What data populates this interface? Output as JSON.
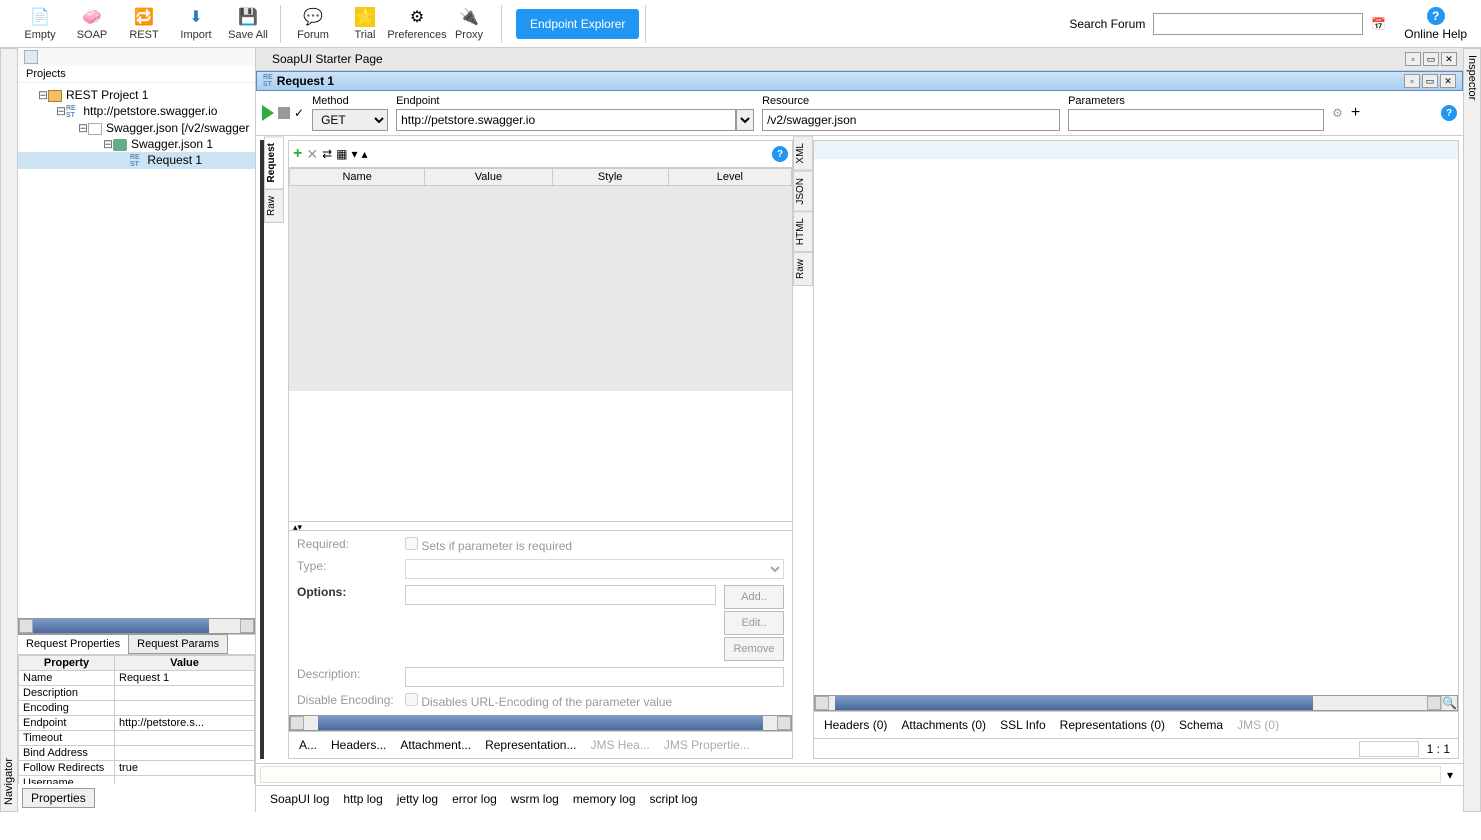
{
  "toolbar": {
    "items": [
      {
        "label": "Empty",
        "icon": "📄"
      },
      {
        "label": "SOAP",
        "icon": "🧼"
      },
      {
        "label": "REST",
        "icon": "🔁"
      },
      {
        "label": "Import",
        "icon": "⬇"
      },
      {
        "label": "Save All",
        "icon": "💾"
      },
      {
        "label": "Forum",
        "icon": "💬"
      },
      {
        "label": "Trial",
        "icon": "⭐"
      },
      {
        "label": "Preferences",
        "icon": "⚙"
      },
      {
        "label": "Proxy",
        "icon": "🔌"
      }
    ],
    "endpoint_explorer": "Endpoint Explorer",
    "search_label": "Search Forum",
    "search_placeholder": "",
    "help_label": "Online Help"
  },
  "side_nav_left": "Navigator",
  "side_nav_right": "Inspector",
  "projects_label": "Projects",
  "tree": [
    {
      "label": "REST Project 1",
      "indent": 0,
      "icon": "folder",
      "exp": "⊟"
    },
    {
      "label": "http://petstore.swagger.io",
      "indent": 1,
      "icon": "rest",
      "exp": "⊟"
    },
    {
      "label": "Swagger.json [/v2/swagger",
      "indent": 2,
      "icon": "file",
      "exp": "⊟"
    },
    {
      "label": "Swagger.json 1",
      "indent": 3,
      "icon": "swag",
      "exp": "⊟"
    },
    {
      "label": "Request 1",
      "indent": 4,
      "icon": "rest",
      "selected": true
    }
  ],
  "prop_tabs": [
    {
      "label": "Request Properties",
      "active": true
    },
    {
      "label": "Request Params"
    }
  ],
  "prop_table": {
    "headers": [
      "Property",
      "Value"
    ],
    "rows": [
      [
        "Name",
        "Request 1"
      ],
      [
        "Description",
        ""
      ],
      [
        "Encoding",
        ""
      ],
      [
        "Endpoint",
        "http://petstore.s..."
      ],
      [
        "Timeout",
        ""
      ],
      [
        "Bind Address",
        ""
      ],
      [
        "Follow Redirects",
        "true"
      ],
      [
        "Username",
        ""
      ]
    ]
  },
  "properties_btn": "Properties",
  "outer_tab": "SoapUI Starter Page",
  "request_tab": "Request 1",
  "editor": {
    "method_label": "Method",
    "method": "GET",
    "endpoint_label": "Endpoint",
    "endpoint": "http://petstore.swagger.io",
    "resource_label": "Resource",
    "resource": "/v2/swagger.json",
    "parameters_label": "Parameters",
    "parameters": ""
  },
  "param_grid": {
    "headers": [
      "Name",
      "Value",
      "Style",
      "Level"
    ]
  },
  "param_detail": {
    "required_label": "Required:",
    "required_hint": "Sets if parameter is required",
    "type_label": "Type:",
    "options_label": "Options:",
    "add": "Add..",
    "edit": "Edit..",
    "remove": "Remove",
    "description_label": "Description:",
    "disable_enc_label": "Disable Encoding:",
    "disable_enc_hint": "Disables URL-Encoding of the parameter value"
  },
  "left_vtabs": [
    "Request",
    "Raw"
  ],
  "right_vtabs": [
    "XML",
    "JSON",
    "HTML",
    "Raw"
  ],
  "left_bottom_tabs": [
    "A...",
    "Headers...",
    "Attachment...",
    "Representation...",
    "JMS Hea...",
    "JMS Propertie..."
  ],
  "right_bottom_tabs": [
    "Headers (0)",
    "Attachments (0)",
    "SSL Info",
    "Representations (0)",
    "Schema",
    "JMS (0)"
  ],
  "status_ratio": "1 : 1",
  "log_tabs": [
    "SoapUI log",
    "http log",
    "jetty log",
    "error log",
    "wsrm log",
    "memory log",
    "script log"
  ]
}
